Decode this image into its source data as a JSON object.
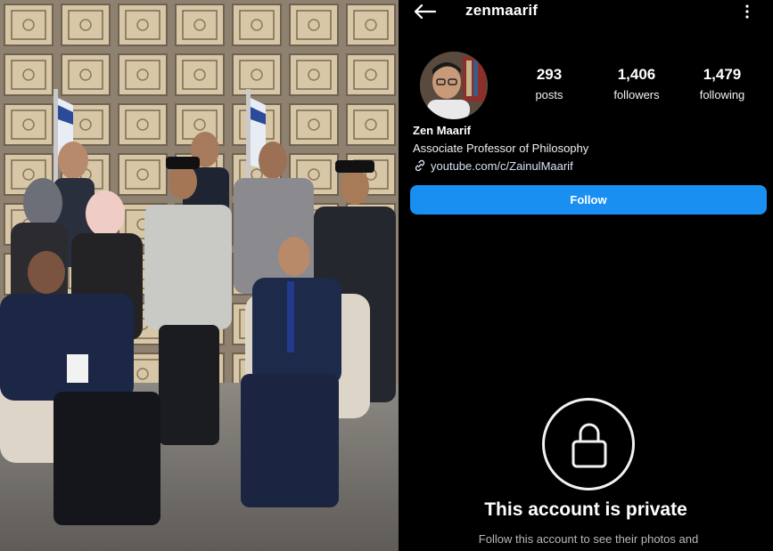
{
  "profile": {
    "username": "zenmaarif",
    "name": "Zen Maarif",
    "bio": "Associate Professor of Philosophy",
    "link": "youtube.com/c/ZainulMaarif"
  },
  "stats": {
    "posts": {
      "value": "293",
      "label": "posts"
    },
    "followers": {
      "value": "1,406",
      "label": "followers"
    },
    "following": {
      "value": "1,479",
      "label": "following"
    }
  },
  "actions": {
    "follow_label": "Follow"
  },
  "private_notice": {
    "title": "This account is private",
    "subtitle": "Follow this account to see their photos and"
  },
  "icons": {
    "back": "arrow-left-icon",
    "more": "more-vertical-icon",
    "link": "link-icon",
    "lock": "lock-icon"
  },
  "colors": {
    "background": "#000000",
    "follow_button": "#1a8ff2",
    "text": "#ffffff",
    "muted_text": "#b8b8b8"
  }
}
